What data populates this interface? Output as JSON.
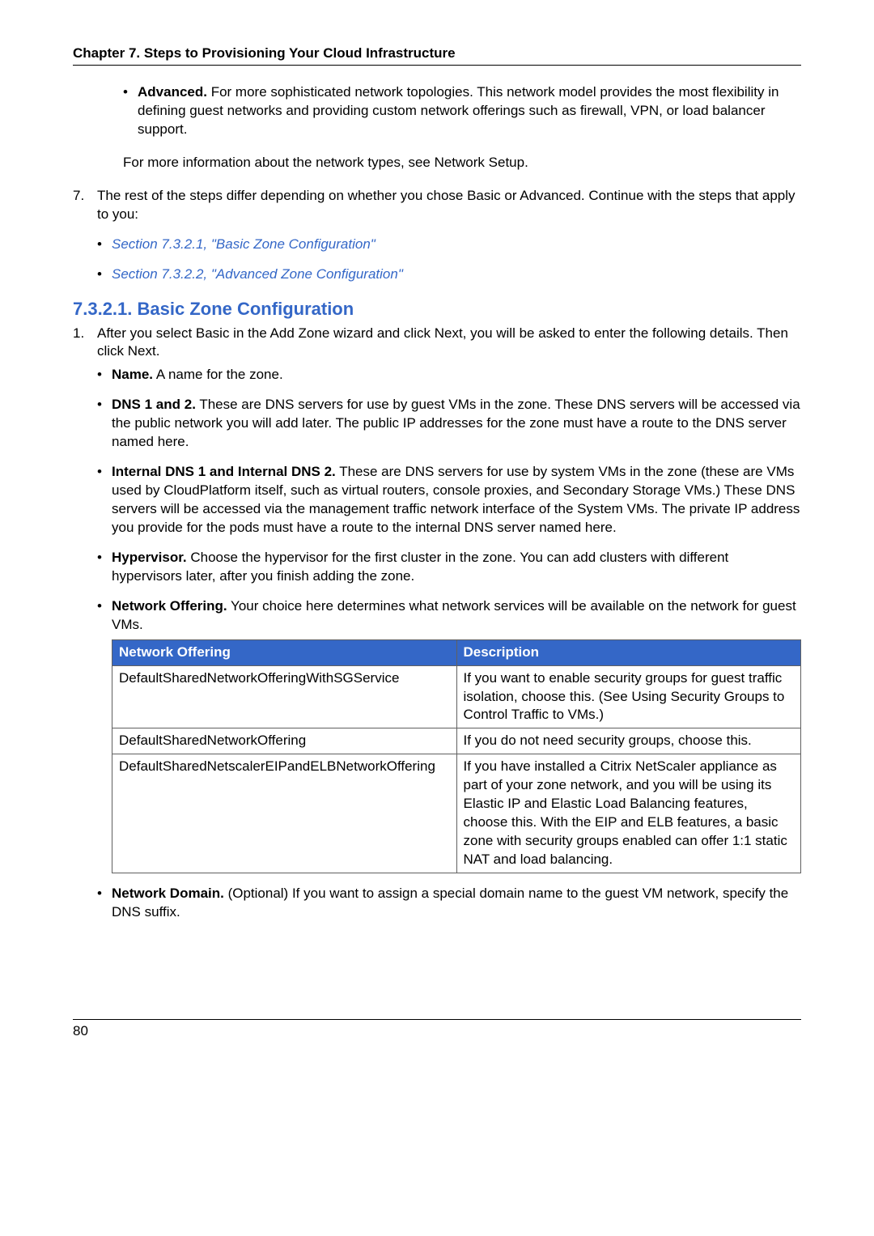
{
  "header": {
    "title": "Chapter 7. Steps to Provisioning Your Cloud Infrastructure"
  },
  "top_bullets": {
    "advanced_label": "Advanced.",
    "advanced_text": " For more sophisticated network topologies. This network model provides the most flexibility in defining guest networks and providing custom network offerings such as firewall, VPN, or load balancer support."
  },
  "para1": "For more information about the network types, see Network Setup.",
  "step7": {
    "num": "7.",
    "text": "The rest of the steps differ depending on whether you chose Basic or Advanced. Continue with the steps that apply to you:",
    "link1": "Section 7.3.2.1, \"Basic Zone Configuration\"",
    "link2": "Section 7.3.2.2, \"Advanced Zone Configuration\""
  },
  "section": {
    "title": "7.3.2.1. Basic Zone Configuration"
  },
  "step1": {
    "num": "1.",
    "text": "After you select Basic in the Add Zone wizard and click Next, you will be asked to enter the following details. Then click Next.",
    "items": {
      "name_label": "Name.",
      "name_text": " A name for the zone.",
      "dns_label": "DNS 1 and 2.",
      "dns_text": " These are DNS servers for use by guest VMs in the zone. These DNS servers will be accessed via the public network you will add later. The public IP addresses for the zone must have a route to the DNS server named here.",
      "idns_label": "Internal DNS 1 and Internal DNS 2.",
      "idns_text": " These are DNS servers for use by system VMs in the zone (these are VMs used by CloudPlatform itself, such as virtual routers, console proxies, and Secondary Storage VMs.) These DNS servers will be accessed via the management traffic network interface of the System VMs. The private IP address you provide for the pods must have a route to the internal DNS server named here.",
      "hyp_label": "Hypervisor.",
      "hyp_text": " Choose the hypervisor for the first cluster in the zone. You can add clusters with different hypervisors later, after you finish adding the zone.",
      "netoff_label": "Network Offering.",
      "netoff_text": " Your choice here determines what network services will be available on the network for guest VMs."
    }
  },
  "table": {
    "h1": "Network Offering",
    "h2": "Description",
    "r1c1": "DefaultSharedNetworkOfferingWithSGService",
    "r1c2": "If you want to enable security groups for guest traffic isolation, choose this. (See Using Security Groups to Control Traffic to VMs.)",
    "r2c1": "DefaultSharedNetworkOffering",
    "r2c2": "If you do not need security groups, choose this.",
    "r3c1": "DefaultSharedNetscalerEIPandELBNetworkOffering",
    "r3c2": "If you have installed a Citrix NetScaler appliance as part of your zone network, and you will be using its Elastic IP and Elastic Load Balancing features, choose this. With the EIP and ELB features, a basic zone with security groups enabled can offer 1:1 static NAT and load balancing."
  },
  "after_table": {
    "label": "Network Domain.",
    "text": " (Optional) If you want to assign a special domain name to the guest VM network, specify the DNS suffix."
  },
  "footer": {
    "page": "80"
  }
}
